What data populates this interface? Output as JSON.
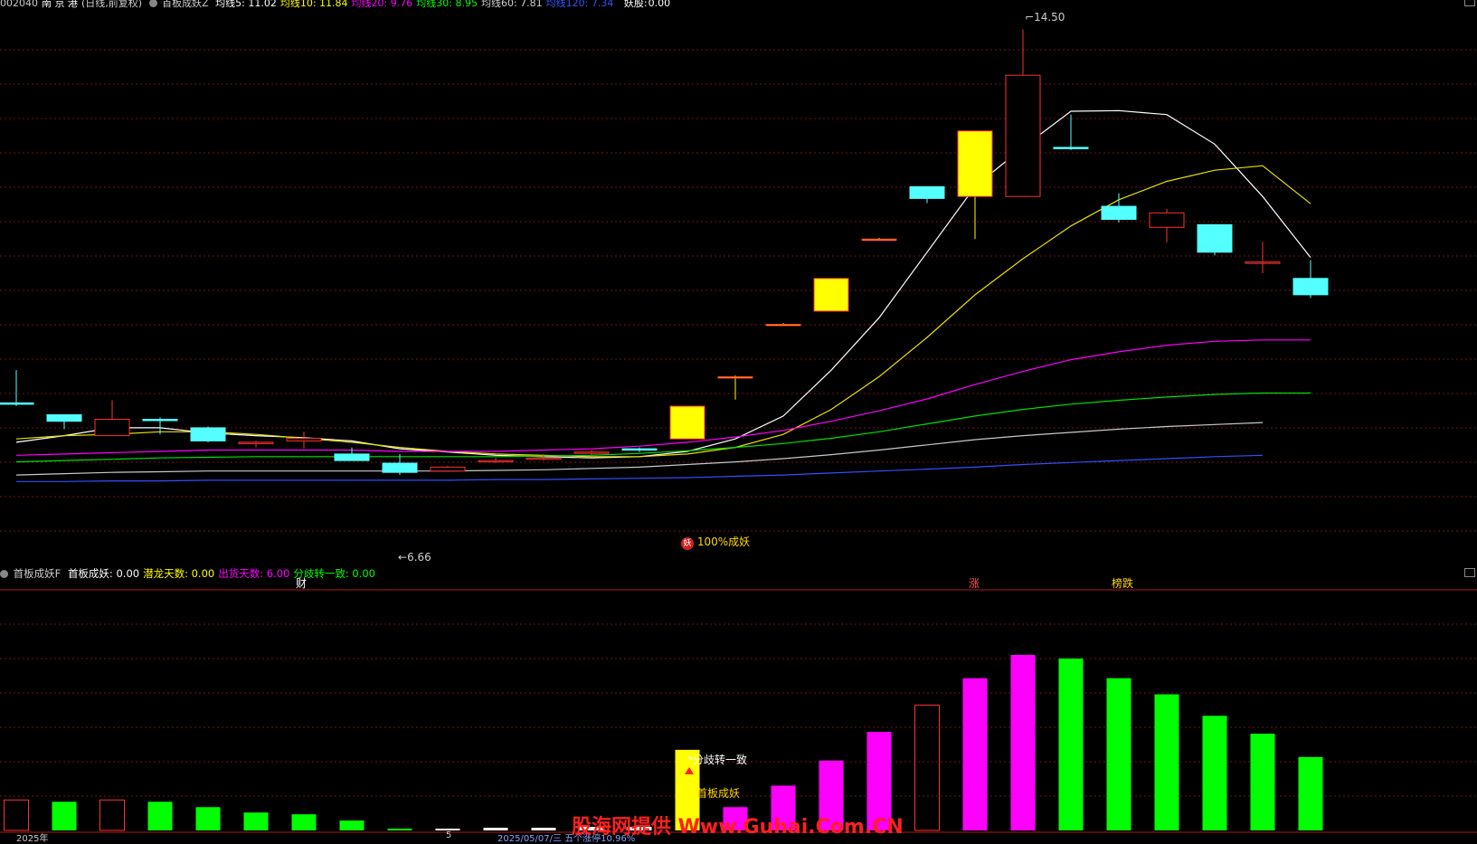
{
  "header": {
    "symbol_code": "002040",
    "name": "南 京 港",
    "period": "(日线,前复权)",
    "indicator": "首板成妖Z",
    "ma": [
      {
        "label": "均线5:",
        "value": "11.02",
        "color": "#ffffff"
      },
      {
        "label": "均线10:",
        "value": "11.84",
        "color": "#ffff00"
      },
      {
        "label": "均线20:",
        "value": "9.76",
        "color": "#ff00ff"
      },
      {
        "label": "均线30:",
        "value": "8.95",
        "color": "#00ff00"
      },
      {
        "label": "均线60:",
        "value": "7.81",
        "color": "#d0d0d0"
      },
      {
        "label": "均线120:",
        "value": "7.34",
        "color": "#3355ff"
      }
    ],
    "extra_label": "妖股:",
    "extra_value": "0.00"
  },
  "sub_header": {
    "indicator": "首板成妖F",
    "fields": [
      {
        "label": "首板成妖:",
        "value": "0.00",
        "color": "#ffffff"
      },
      {
        "label": "潜龙天数:",
        "value": "0.00",
        "color": "#ffff00"
      },
      {
        "label": "出货天数:",
        "value": "6.00",
        "color": "#ff00ff"
      },
      {
        "label": "分歧转一致:",
        "value": "0.00",
        "color": "#00ff00"
      }
    ]
  },
  "annotations": {
    "high_label": "14.50",
    "low_label": "6.66",
    "signal_icon": "妖",
    "signal_text": "100%成妖",
    "event_cai": "财",
    "event_zhang": "涨",
    "event_bang": "榜跌",
    "sub_divergence": "分歧转一致",
    "sub_first_board": "首板成妖"
  },
  "bottom_axis": {
    "year": "2025年",
    "month": "5",
    "date_info": "2025/05/07/三  五个涨停10.96%"
  },
  "watermark": "股海网提供 Www.Guhai.Com.CN",
  "chart_data": [
    {
      "type": "candlestick",
      "title": "南 京 港 (日线,前复权)",
      "y_range": [
        6.5,
        14.7
      ],
      "candles": [
        {
          "o": 8.8,
          "h": 9.3,
          "l": 8.75,
          "c": 8.8,
          "color": "cyan"
        },
        {
          "o": 8.52,
          "h": 8.55,
          "l": 8.4,
          "c": 8.62,
          "color": "cyan"
        },
        {
          "o": 8.3,
          "h": 8.84,
          "l": 8.3,
          "c": 8.55,
          "color": "red"
        },
        {
          "o": 8.55,
          "h": 8.58,
          "l": 8.32,
          "c": 8.53,
          "color": "cyan"
        },
        {
          "o": 8.42,
          "h": 8.44,
          "l": 8.2,
          "c": 8.22,
          "color": "cyan"
        },
        {
          "o": 8.2,
          "h": 8.22,
          "l": 8.12,
          "c": 8.18,
          "color": "red"
        },
        {
          "o": 8.22,
          "h": 8.36,
          "l": 8.1,
          "c": 8.26,
          "color": "red"
        },
        {
          "o": 7.92,
          "h": 8.12,
          "l": 7.92,
          "c": 8.02,
          "color": "cyan"
        },
        {
          "o": 7.88,
          "h": 8.02,
          "l": 7.7,
          "c": 7.74,
          "color": "cyan"
        },
        {
          "o": 7.76,
          "h": 7.84,
          "l": 7.76,
          "c": 7.82,
          "color": "red"
        },
        {
          "o": 7.92,
          "h": 7.96,
          "l": 7.88,
          "c": 7.92,
          "color": "red"
        },
        {
          "o": 7.96,
          "h": 8.02,
          "l": 7.92,
          "c": 7.96,
          "color": "red"
        },
        {
          "o": 8.05,
          "h": 8.08,
          "l": 8.0,
          "c": 8.05,
          "color": "red"
        },
        {
          "o": 8.1,
          "h": 8.12,
          "l": 8.05,
          "c": 8.08,
          "color": "cyan"
        },
        {
          "o": 8.25,
          "h": 8.75,
          "l": 8.25,
          "c": 8.75,
          "color": "yellow"
        },
        {
          "o": 9.2,
          "h": 9.22,
          "l": 8.85,
          "c": 9.2,
          "color": "yellow"
        },
        {
          "o": 10.0,
          "h": 10.02,
          "l": 10.0,
          "c": 10.0,
          "color": "yellow"
        },
        {
          "o": 10.2,
          "h": 10.7,
          "l": 10.2,
          "c": 10.7,
          "color": "yellow"
        },
        {
          "o": 11.3,
          "h": 11.32,
          "l": 11.3,
          "c": 11.3,
          "color": "yellow"
        },
        {
          "o": 12.1,
          "h": 12.1,
          "l": 11.85,
          "c": 11.92,
          "color": "cyan"
        },
        {
          "o": 11.95,
          "h": 12.95,
          "l": 11.3,
          "c": 12.95,
          "color": "yellow"
        },
        {
          "o": 11.95,
          "h": 14.5,
          "l": 11.95,
          "c": 13.8,
          "color": "red"
        },
        {
          "o": 12.7,
          "h": 13.2,
          "l": 12.66,
          "c": 12.7,
          "color": "cyan"
        },
        {
          "o": 11.8,
          "h": 12.0,
          "l": 11.55,
          "c": 11.6,
          "color": "cyan"
        },
        {
          "o": 11.7,
          "h": 11.76,
          "l": 11.25,
          "c": 11.48,
          "color": "red"
        },
        {
          "o": 11.52,
          "h": 11.52,
          "l": 11.05,
          "c": 11.1,
          "color": "cyan"
        },
        {
          "o": 10.95,
          "h": 11.26,
          "l": 10.78,
          "c": 10.95,
          "color": "red"
        },
        {
          "o": 10.7,
          "h": 10.98,
          "l": 10.4,
          "c": 10.45,
          "color": "cyan"
        }
      ],
      "ma_lines": {
        "MA5": [
          8.2,
          8.3,
          8.42,
          8.42,
          8.34,
          8.3,
          8.27,
          8.22,
          8.1,
          8.05,
          8.0,
          7.98,
          7.96,
          7.98,
          8.06,
          8.25,
          8.6,
          9.3,
          10.1,
          11.1,
          12.1,
          12.7,
          13.25,
          13.26,
          13.2,
          12.75,
          11.95,
          11.02
        ],
        "MA10": [
          8.25,
          8.3,
          8.32,
          8.36,
          8.36,
          8.32,
          8.26,
          8.2,
          8.12,
          8.06,
          8.02,
          8.0,
          7.98,
          7.98,
          8.02,
          8.12,
          8.32,
          8.7,
          9.2,
          9.8,
          10.45,
          11.0,
          11.5,
          11.9,
          12.18,
          12.35,
          12.42,
          11.84
        ],
        "MA20": [
          8.0,
          8.02,
          8.04,
          8.06,
          8.08,
          8.08,
          8.08,
          8.08,
          8.06,
          8.06,
          8.06,
          8.08,
          8.1,
          8.14,
          8.2,
          8.28,
          8.38,
          8.52,
          8.68,
          8.86,
          9.08,
          9.28,
          9.46,
          9.58,
          9.68,
          9.74,
          9.76,
          9.76
        ],
        "MA30": [
          7.9,
          7.92,
          7.94,
          7.96,
          7.97,
          7.98,
          7.98,
          7.98,
          7.98,
          7.98,
          7.98,
          7.99,
          8.0,
          8.03,
          8.07,
          8.12,
          8.18,
          8.26,
          8.36,
          8.48,
          8.6,
          8.7,
          8.78,
          8.84,
          8.89,
          8.93,
          8.95,
          8.95
        ],
        "MA60": [
          7.7,
          7.72,
          7.74,
          7.75,
          7.76,
          7.76,
          7.76,
          7.76,
          7.76,
          7.76,
          7.77,
          7.78,
          7.8,
          7.82,
          7.86,
          7.9,
          7.95,
          8.01,
          8.08,
          8.16,
          8.24,
          8.3,
          8.35,
          8.4,
          8.44,
          8.47,
          8.5,
          7.81
        ],
        "MA120": [
          7.6,
          7.6,
          7.61,
          7.61,
          7.62,
          7.62,
          7.62,
          7.62,
          7.62,
          7.62,
          7.63,
          7.63,
          7.64,
          7.65,
          7.66,
          7.68,
          7.7,
          7.73,
          7.76,
          7.79,
          7.82,
          7.86,
          7.89,
          7.92,
          7.95,
          7.98,
          8.0,
          7.34
        ]
      }
    },
    {
      "type": "bar",
      "title": "首板成妖F",
      "y_range": [
        0,
        10
      ],
      "values": [
        1.7,
        1.6,
        1.7,
        1.6,
        1.3,
        1.0,
        0.9,
        0.55,
        0.1,
        0.1,
        0.15,
        0.15,
        0.2,
        0.2,
        4.5,
        1.3,
        2.5,
        3.9,
        5.5,
        7.0,
        8.5,
        9.8,
        9.6,
        8.5,
        7.6,
        6.4,
        5.4,
        4.1
      ],
      "colors": [
        "red-hollow",
        "green",
        "red-hollow",
        "green",
        "green",
        "green",
        "green",
        "green",
        "green",
        "white",
        "white",
        "white",
        "white",
        "white",
        "yellow",
        "magenta",
        "magenta",
        "magenta",
        "magenta",
        "red-hollow",
        "magenta",
        "magenta",
        "green",
        "green",
        "green",
        "green",
        "green",
        "green"
      ]
    }
  ]
}
